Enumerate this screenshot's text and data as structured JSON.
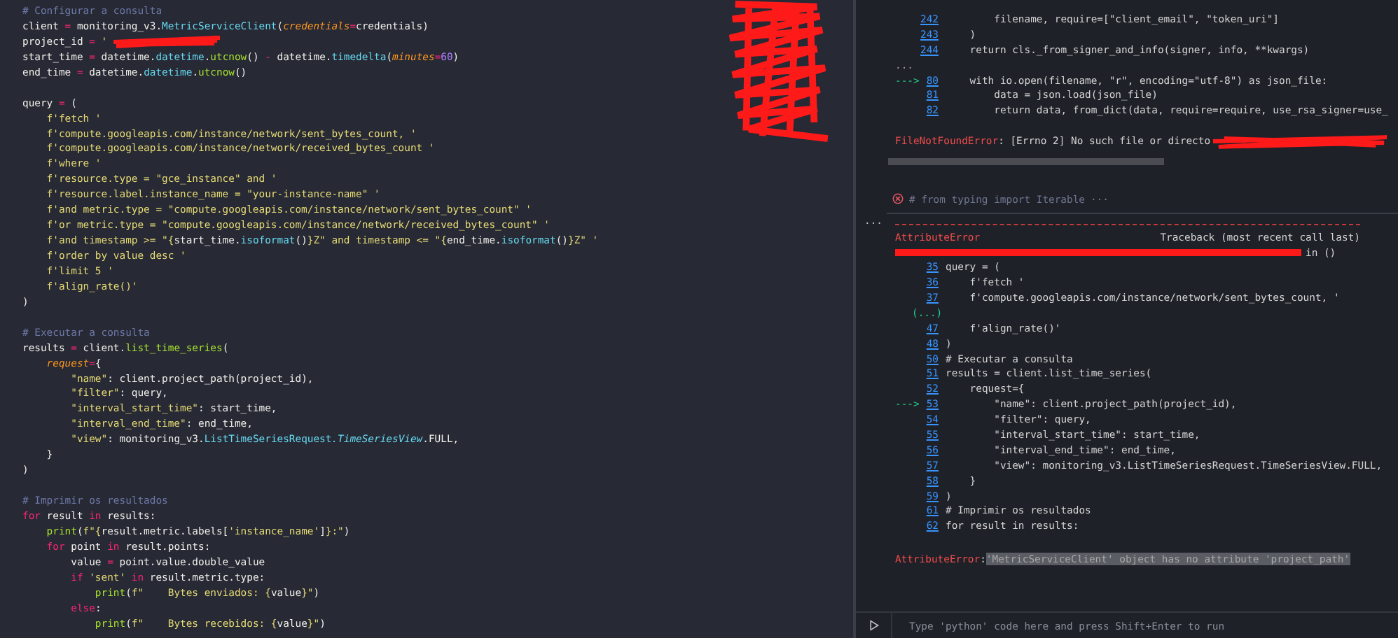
{
  "editor": {
    "redacted_overlay": true,
    "lines": [
      {
        "kind": "code",
        "tokens": [
          {
            "text": "# Configurar a consulta",
            "kind": "comment"
          }
        ]
      },
      {
        "kind": "code",
        "tokens": [
          {
            "text": "client ",
            "kind": "plain"
          },
          {
            "text": "=",
            "kind": "op"
          },
          {
            "text": " monitoring_v3.",
            "kind": "plain"
          },
          {
            "text": "MetricServiceClient",
            "kind": "type"
          },
          {
            "text": "(",
            "kind": "plain"
          },
          {
            "text": "credentials",
            "kind": "param"
          },
          {
            "text": "=",
            "kind": "op"
          },
          {
            "text": "credentials)",
            "kind": "plain"
          }
        ]
      },
      {
        "kind": "code",
        "redacted": true,
        "tokens": [
          {
            "text": "project_id ",
            "kind": "plain"
          },
          {
            "text": "=",
            "kind": "op"
          },
          {
            "text": " '",
            "kind": "string"
          }
        ]
      },
      {
        "kind": "code",
        "tokens": [
          {
            "text": "start_time ",
            "kind": "plain"
          },
          {
            "text": "=",
            "kind": "op"
          },
          {
            "text": " datetime.",
            "kind": "plain"
          },
          {
            "text": "datetime",
            "kind": "type"
          },
          {
            "text": ".",
            "kind": "plain"
          },
          {
            "text": "utcnow",
            "kind": "func"
          },
          {
            "text": "() ",
            "kind": "plain"
          },
          {
            "text": "-",
            "kind": "op"
          },
          {
            "text": " datetime.",
            "kind": "plain"
          },
          {
            "text": "timedelta",
            "kind": "type"
          },
          {
            "text": "(",
            "kind": "plain"
          },
          {
            "text": "minutes",
            "kind": "param"
          },
          {
            "text": "=",
            "kind": "op"
          },
          {
            "text": "60",
            "kind": "number"
          },
          {
            "text": ")",
            "kind": "plain"
          }
        ]
      },
      {
        "kind": "code",
        "tokens": [
          {
            "text": "end_time ",
            "kind": "plain"
          },
          {
            "text": "=",
            "kind": "op"
          },
          {
            "text": " datetime.",
            "kind": "plain"
          },
          {
            "text": "datetime",
            "kind": "type"
          },
          {
            "text": ".",
            "kind": "plain"
          },
          {
            "text": "utcnow",
            "kind": "func"
          },
          {
            "text": "()",
            "kind": "plain"
          }
        ]
      },
      {
        "kind": "blank"
      },
      {
        "kind": "code",
        "tokens": [
          {
            "text": "query ",
            "kind": "plain"
          },
          {
            "text": "=",
            "kind": "op"
          },
          {
            "text": " (",
            "kind": "plain"
          }
        ]
      },
      {
        "kind": "code",
        "tokens": [
          {
            "text": "    f'fetch '",
            "kind": "string"
          }
        ]
      },
      {
        "kind": "code",
        "tokens": [
          {
            "text": "    f'compute.googleapis.com/instance/network/sent_bytes_count, '",
            "kind": "string"
          }
        ]
      },
      {
        "kind": "code",
        "tokens": [
          {
            "text": "    f'compute.googleapis.com/instance/network/received_bytes_count '",
            "kind": "string"
          }
        ]
      },
      {
        "kind": "code",
        "tokens": [
          {
            "text": "    f'where '",
            "kind": "string"
          }
        ]
      },
      {
        "kind": "code",
        "tokens": [
          {
            "text": "    f'resource.type = \"gce_instance\" and '",
            "kind": "string"
          }
        ]
      },
      {
        "kind": "code",
        "tokens": [
          {
            "text": "    f'resource.label.instance_name = \"your-instance-name\" '",
            "kind": "string"
          }
        ]
      },
      {
        "kind": "code",
        "tokens": [
          {
            "text": "    f'and metric.type = \"compute.googleapis.com/instance/network/sent_bytes_count\" '",
            "kind": "string"
          }
        ]
      },
      {
        "kind": "code",
        "tokens": [
          {
            "text": "    f'or metric.type = \"compute.googleapis.com/instance/network/received_bytes_count\" '",
            "kind": "string"
          }
        ]
      },
      {
        "kind": "code",
        "tokens": [
          {
            "text": "    f'and timestamp >= \"{",
            "kind": "string"
          },
          {
            "text": "start_time.",
            "kind": "plain"
          },
          {
            "text": "isoformat",
            "kind": "type"
          },
          {
            "text": "()",
            "kind": "plain"
          },
          {
            "text": "}Z\" and timestamp <= \"{",
            "kind": "string"
          },
          {
            "text": "end_time.",
            "kind": "plain"
          },
          {
            "text": "isoformat",
            "kind": "type"
          },
          {
            "text": "()",
            "kind": "plain"
          },
          {
            "text": "}Z\" '",
            "kind": "string"
          }
        ]
      },
      {
        "kind": "code",
        "tokens": [
          {
            "text": "    f'order by value desc '",
            "kind": "string"
          }
        ]
      },
      {
        "kind": "code",
        "tokens": [
          {
            "text": "    f'limit 5 '",
            "kind": "string"
          }
        ]
      },
      {
        "kind": "code",
        "tokens": [
          {
            "text": "    f'align_rate()'",
            "kind": "string"
          }
        ]
      },
      {
        "kind": "code",
        "tokens": [
          {
            "text": ")",
            "kind": "plain"
          }
        ]
      },
      {
        "kind": "blank"
      },
      {
        "kind": "code",
        "tokens": [
          {
            "text": "# Executar a consulta",
            "kind": "comment"
          }
        ]
      },
      {
        "kind": "code",
        "tokens": [
          {
            "text": "results ",
            "kind": "plain"
          },
          {
            "text": "=",
            "kind": "op"
          },
          {
            "text": " client.",
            "kind": "plain"
          },
          {
            "text": "list_time_series",
            "kind": "func"
          },
          {
            "text": "(",
            "kind": "plain"
          }
        ]
      },
      {
        "kind": "code",
        "tokens": [
          {
            "text": "    request",
            "kind": "param"
          },
          {
            "text": "=",
            "kind": "op"
          },
          {
            "text": "{",
            "kind": "plain"
          }
        ]
      },
      {
        "kind": "code",
        "tokens": [
          {
            "text": "        \"name\"",
            "kind": "string"
          },
          {
            "text": ": client.project_path(project_id),",
            "kind": "plain"
          }
        ]
      },
      {
        "kind": "code",
        "tokens": [
          {
            "text": "        \"filter\"",
            "kind": "string"
          },
          {
            "text": ": query,",
            "kind": "plain"
          }
        ]
      },
      {
        "kind": "code",
        "tokens": [
          {
            "text": "        \"interval_start_time\"",
            "kind": "string"
          },
          {
            "text": ": start_time,",
            "kind": "plain"
          }
        ]
      },
      {
        "kind": "code",
        "tokens": [
          {
            "text": "        \"interval_end_time\"",
            "kind": "string"
          },
          {
            "text": ": end_time,",
            "kind": "plain"
          }
        ]
      },
      {
        "kind": "code",
        "tokens": [
          {
            "text": "        \"view\"",
            "kind": "string"
          },
          {
            "text": ": monitoring_v3.",
            "kind": "plain"
          },
          {
            "text": "ListTimeSeriesRequest",
            "kind": "type"
          },
          {
            "text": ".TimeSeriesView",
            "kind": "type_italic"
          },
          {
            "text": ".FULL,",
            "kind": "plain"
          }
        ]
      },
      {
        "kind": "code",
        "tokens": [
          {
            "text": "    }",
            "kind": "plain"
          }
        ]
      },
      {
        "kind": "code",
        "tokens": [
          {
            "text": ")",
            "kind": "plain"
          }
        ]
      },
      {
        "kind": "blank"
      },
      {
        "kind": "code",
        "tokens": [
          {
            "text": "# Imprimir os resultados",
            "kind": "comment"
          }
        ]
      },
      {
        "kind": "code",
        "tokens": [
          {
            "text": "for",
            "kind": "keyword"
          },
          {
            "text": " result ",
            "kind": "plain"
          },
          {
            "text": "in",
            "kind": "keyword"
          },
          {
            "text": " results:",
            "kind": "plain"
          }
        ]
      },
      {
        "kind": "code",
        "tokens": [
          {
            "text": "    print",
            "kind": "func"
          },
          {
            "text": "(",
            "kind": "plain"
          },
          {
            "text": "f\"{",
            "kind": "string"
          },
          {
            "text": "result.metric.labels[",
            "kind": "plain"
          },
          {
            "text": "'instance_name'",
            "kind": "string"
          },
          {
            "text": "]",
            "kind": "plain"
          },
          {
            "text": "}:\"",
            "kind": "string"
          },
          {
            "text": ")",
            "kind": "plain"
          }
        ]
      },
      {
        "kind": "code",
        "tokens": [
          {
            "text": "    for",
            "kind": "keyword"
          },
          {
            "text": " point ",
            "kind": "plain"
          },
          {
            "text": "in",
            "kind": "keyword"
          },
          {
            "text": " result.points:",
            "kind": "plain"
          }
        ]
      },
      {
        "kind": "code",
        "tokens": [
          {
            "text": "        value ",
            "kind": "plain"
          },
          {
            "text": "=",
            "kind": "op"
          },
          {
            "text": " point.value.double_value",
            "kind": "plain"
          }
        ]
      },
      {
        "kind": "code",
        "tokens": [
          {
            "text": "        if",
            "kind": "keyword"
          },
          {
            "text": " 'sent'",
            "kind": "string"
          },
          {
            "text": " in",
            "kind": "keyword"
          },
          {
            "text": " result.metric.type:",
            "kind": "plain"
          }
        ]
      },
      {
        "kind": "code",
        "tokens": [
          {
            "text": "            print",
            "kind": "func"
          },
          {
            "text": "(",
            "kind": "plain"
          },
          {
            "text": "f\"    Bytes enviados: {",
            "kind": "string"
          },
          {
            "text": "value",
            "kind": "plain"
          },
          {
            "text": "}\"",
            "kind": "string"
          },
          {
            "text": ")",
            "kind": "plain"
          }
        ]
      },
      {
        "kind": "code",
        "tokens": [
          {
            "text": "        else",
            "kind": "keyword"
          },
          {
            "text": ":",
            "kind": "plain"
          }
        ]
      },
      {
        "kind": "code",
        "tokens": [
          {
            "text": "            print",
            "kind": "func"
          },
          {
            "text": "(",
            "kind": "plain"
          },
          {
            "text": "f\"    Bytes recebidos: {",
            "kind": "string"
          },
          {
            "text": "value",
            "kind": "plain"
          },
          {
            "text": "}\"",
            "kind": "string"
          },
          {
            "text": ")",
            "kind": "plain"
          }
        ]
      }
    ]
  },
  "interactive": {
    "prior_output": {
      "frames": [
        {
          "kind": "line",
          "number": "242",
          "code": "        filename, require=[\"client_email\", \"token_uri\"]"
        },
        {
          "kind": "line",
          "number": "243",
          "code": "    )"
        },
        {
          "kind": "line",
          "number": "244",
          "code": "    return cls._from_signer_and_info(signer, info, **kwargs)"
        },
        {
          "kind": "ellipsis",
          "text": "..."
        },
        {
          "kind": "line",
          "arrow": "--->",
          "number": "80",
          "code": "    with io.open(filename, \"r\", encoding=\"utf-8\") as json_file:"
        },
        {
          "kind": "line",
          "number": "81",
          "code": "        data = json.load(json_file)"
        },
        {
          "kind": "line",
          "number": "82",
          "code": "        return data, from_dict(data, require=require, use_rsa_signer=use_"
        }
      ],
      "error": {
        "name": "FileNotFoundError",
        "message": ": [Errno 2] No such file or directo",
        "redacted": true,
        "highlighted": false
      }
    },
    "collapsed_cell": {
      "code": "# from typing import Iterable",
      "more": "···"
    },
    "current_output": {
      "more": "···",
      "error_name": "AttributeError",
      "header": "Traceback (most recent call last)",
      "location_redacted": true,
      "location": "in ()",
      "frames": [
        {
          "kind": "line",
          "number": "35",
          "code": "query = ("
        },
        {
          "kind": "line",
          "number": "36",
          "code": "    f'fetch '"
        },
        {
          "kind": "line",
          "number": "37",
          "code": "    f'compute.googleapis.com/instance/network/sent_bytes_count, '"
        },
        {
          "kind": "skipped",
          "text": "(...)"
        },
        {
          "kind": "line",
          "number": "47",
          "code": "    f'align_rate()'"
        },
        {
          "kind": "line",
          "number": "48",
          "code": ")"
        },
        {
          "kind": "line",
          "number": "50",
          "code": "# Executar a consulta"
        },
        {
          "kind": "line",
          "number": "51",
          "code": "results = client.list_time_series("
        },
        {
          "kind": "line",
          "number": "52",
          "code": "    request={"
        },
        {
          "kind": "line",
          "arrow": "--->",
          "number": "53",
          "code": "        \"name\": client.project_path(project_id),"
        },
        {
          "kind": "line",
          "number": "54",
          "code": "        \"filter\": query,"
        },
        {
          "kind": "line",
          "number": "55",
          "code": "        \"interval_start_time\": start_time,"
        },
        {
          "kind": "line",
          "number": "56",
          "code": "        \"interval_end_time\": end_time,"
        },
        {
          "kind": "line",
          "number": "57",
          "code": "        \"view\": monitoring_v3.ListTimeSeriesRequest.TimeSeriesView.FULL,"
        },
        {
          "kind": "line",
          "number": "58",
          "code": "    }"
        },
        {
          "kind": "line",
          "number": "59",
          "code": ")"
        },
        {
          "kind": "line",
          "number": "61",
          "code": "# Imprimir os resultados"
        },
        {
          "kind": "line",
          "number": "62",
          "code": "for result in results:"
        }
      ],
      "error": {
        "name": "AttributeError",
        "separator": ":",
        "message": "'MetricServiceClient' object has no attribute 'project_path'",
        "highlighted": true
      }
    },
    "input": {
      "placeholder": "Type 'python' code here and press Shift+Enter to run"
    }
  }
}
